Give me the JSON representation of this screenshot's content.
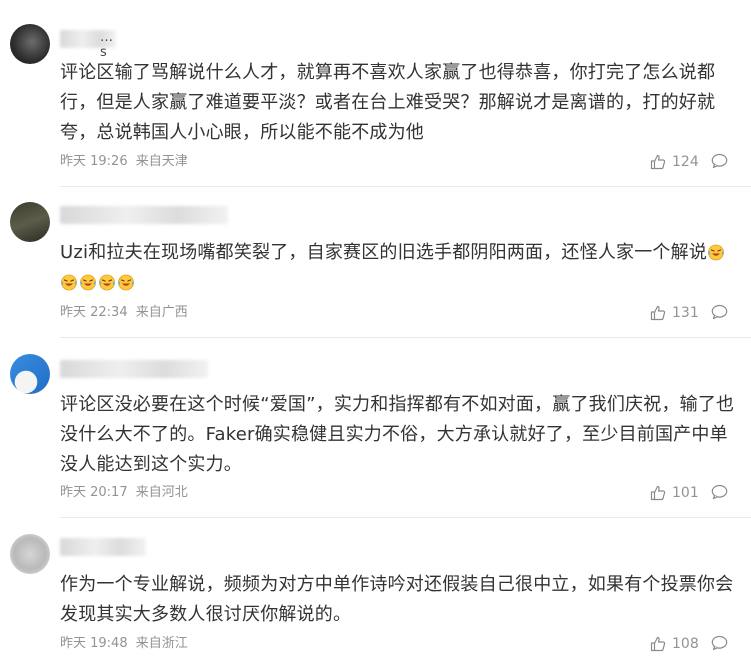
{
  "comments": [
    {
      "username": "…s",
      "text": "评论区输了骂解说什么人才，就算再不喜欢人家赢了也得恭喜，你打完了怎么说都行，但是人家赢了难道要平淡？或者在台上难受哭？那解说才是离谱的，打的好就夸，总说韩国人小心眼，所以能不能不成为他",
      "time": "昨天 19:26",
      "location": "来自天津",
      "likes": "124"
    },
    {
      "username": "",
      "text": "Uzi和拉夫在现场嘴都笑裂了，自家赛区的旧选手都阴阳两面，还怪人家一个解说",
      "emoji_count": 5,
      "time": "昨天 22:34",
      "location": "来自广西",
      "likes": "131"
    },
    {
      "username": "",
      "text": "评论区没必要在这个时候“爱国”，实力和指挥都有不如对面，赢了我们庆祝，输了也没什么大不了的。Faker确实稳健且实力不俗，大方承认就好了，至少目前国产中单没人能达到这个实力。",
      "time": "昨天 20:17",
      "location": "来自河北",
      "likes": "101"
    },
    {
      "username": "",
      "text": "作为一个专业解说，频频为对方中单作诗吟对还假装自己很中立，如果有个投票你会发现其实大多数人很讨厌你解说的。",
      "time": "昨天 19:48",
      "location": "来自浙江",
      "likes": "108"
    }
  ],
  "icons": {
    "like": "thumb-up-icon",
    "reply": "comment-bubble-icon",
    "emoji": "laughing-crying-emoji"
  },
  "colors": {
    "meta": "#939393",
    "text": "#333333"
  }
}
